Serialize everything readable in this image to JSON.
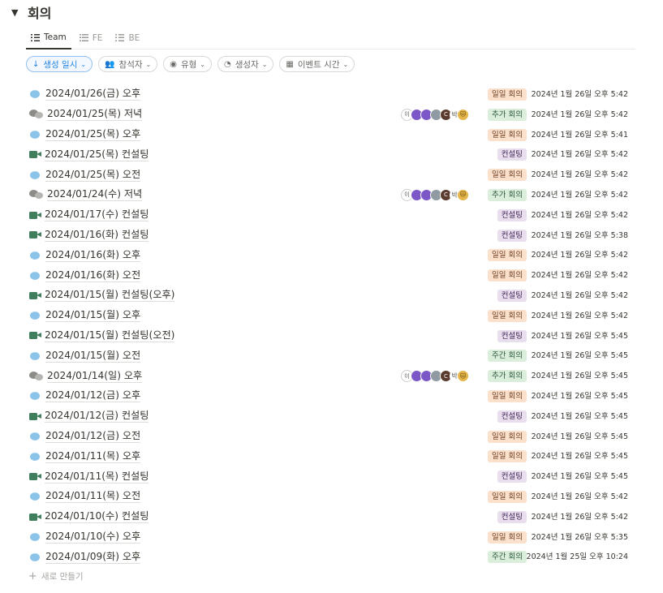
{
  "database": {
    "title": "회의",
    "toggle_icon": "▼"
  },
  "tabs": [
    {
      "label": "Team",
      "icon": "list-icon",
      "active": true
    },
    {
      "label": "FE",
      "icon": "list-icon",
      "active": false
    },
    {
      "label": "BE",
      "icon": "list-icon",
      "active": false
    }
  ],
  "filters": [
    {
      "label": "생성 일시",
      "icon": "↓",
      "kind": "sort"
    },
    {
      "label": "참석자",
      "icon": "👥",
      "kind": "filter"
    },
    {
      "label": "유형",
      "icon": "◉",
      "kind": "filter"
    },
    {
      "label": "생성자",
      "icon": "◔",
      "kind": "filter"
    },
    {
      "label": "이벤트 시간",
      "icon": "▦",
      "kind": "filter"
    }
  ],
  "rows": [
    {
      "icon": "chat",
      "title": "2024/01/26(금) 오후",
      "tag": "일일 회의",
      "tag_type": "daily",
      "created": "2024년 1월 26일 오후 5:42",
      "attendees": false
    },
    {
      "icon": "group",
      "title": "2024/01/25(목) 저녁",
      "tag": "추가 회의",
      "tag_type": "extra",
      "created": "2024년 1월 26일 오후 5:42",
      "attendees": true
    },
    {
      "icon": "chat",
      "title": "2024/01/25(목) 오후",
      "tag": "일일 회의",
      "tag_type": "daily",
      "created": "2024년 1월 26일 오후 5:41",
      "attendees": false
    },
    {
      "icon": "video",
      "title": "2024/01/25(목) 컨설팅",
      "tag": "컨설팅",
      "tag_type": "consult",
      "created": "2024년 1월 26일 오후 5:42",
      "attendees": false
    },
    {
      "icon": "chat",
      "title": "2024/01/25(목) 오전",
      "tag": "일일 회의",
      "tag_type": "daily",
      "created": "2024년 1월 26일 오후 5:42",
      "attendees": false
    },
    {
      "icon": "group",
      "title": "2024/01/24(수) 저녁",
      "tag": "추가 회의",
      "tag_type": "extra",
      "created": "2024년 1월 26일 오후 5:42",
      "attendees": true
    },
    {
      "icon": "video",
      "title": "2024/01/17(수) 컨설팅",
      "tag": "컨설팅",
      "tag_type": "consult",
      "created": "2024년 1월 26일 오후 5:42",
      "attendees": false
    },
    {
      "icon": "video",
      "title": "2024/01/16(화) 컨설팅",
      "tag": "컨설팅",
      "tag_type": "consult",
      "created": "2024년 1월 26일 오후 5:38",
      "attendees": false
    },
    {
      "icon": "chat",
      "title": "2024/01/16(화) 오후",
      "tag": "일일 회의",
      "tag_type": "daily",
      "created": "2024년 1월 26일 오후 5:42",
      "attendees": false
    },
    {
      "icon": "chat",
      "title": "2024/01/16(화) 오전",
      "tag": "일일 회의",
      "tag_type": "daily",
      "created": "2024년 1월 26일 오후 5:42",
      "attendees": false
    },
    {
      "icon": "video",
      "title": "2024/01/15(월) 컨설팅(오후)",
      "tag": "컨설팅",
      "tag_type": "consult",
      "created": "2024년 1월 26일 오후 5:42",
      "attendees": false
    },
    {
      "icon": "chat",
      "title": "2024/01/15(월) 오후",
      "tag": "일일 회의",
      "tag_type": "daily",
      "created": "2024년 1월 26일 오후 5:42",
      "attendees": false
    },
    {
      "icon": "video",
      "title": "2024/01/15(월) 컨설팅(오전)",
      "tag": "컨설팅",
      "tag_type": "consult",
      "created": "2024년 1월 26일 오후 5:45",
      "attendees": false
    },
    {
      "icon": "chat",
      "title": "2024/01/15(월) 오전",
      "tag": "주간 회의",
      "tag_type": "weekly",
      "created": "2024년 1월 26일 오후 5:45",
      "attendees": false
    },
    {
      "icon": "group",
      "title": "2024/01/14(일) 오후",
      "tag": "추가 회의",
      "tag_type": "extra",
      "created": "2024년 1월 26일 오후 5:45",
      "attendees": true
    },
    {
      "icon": "chat",
      "title": "2024/01/12(금) 오후",
      "tag": "일일 회의",
      "tag_type": "daily",
      "created": "2024년 1월 26일 오후 5:45",
      "attendees": false
    },
    {
      "icon": "video",
      "title": "2024/01/12(금) 컨설팅",
      "tag": "컨설팅",
      "tag_type": "consult",
      "created": "2024년 1월 26일 오후 5:45",
      "attendees": false
    },
    {
      "icon": "chat",
      "title": "2024/01/12(금) 오전",
      "tag": "일일 회의",
      "tag_type": "daily",
      "created": "2024년 1월 26일 오후 5:45",
      "attendees": false
    },
    {
      "icon": "chat",
      "title": "2024/01/11(목) 오후",
      "tag": "일일 회의",
      "tag_type": "daily",
      "created": "2024년 1월 26일 오후 5:45",
      "attendees": false
    },
    {
      "icon": "video",
      "title": "2024/01/11(목) 컨설팅",
      "tag": "컨설팅",
      "tag_type": "consult",
      "created": "2024년 1월 26일 오후 5:45",
      "attendees": false
    },
    {
      "icon": "chat",
      "title": "2024/01/11(목) 오전",
      "tag": "일일 회의",
      "tag_type": "daily",
      "created": "2024년 1월 26일 오후 5:42",
      "attendees": false
    },
    {
      "icon": "video",
      "title": "2024/01/10(수) 컨설팅",
      "tag": "컨설팅",
      "tag_type": "consult",
      "created": "2024년 1월 26일 오후 5:42",
      "attendees": false
    },
    {
      "icon": "chat",
      "title": "2024/01/10(수) 오후",
      "tag": "일일 회의",
      "tag_type": "daily",
      "created": "2024년 1월 26일 오후 5:35",
      "attendees": false
    },
    {
      "icon": "chat",
      "title": "2024/01/09(화) 오후",
      "tag": "주간 회의",
      "tag_type": "weekly",
      "created": "2024년 1월 25일 오후 10:24",
      "attendees": false
    }
  ],
  "attendee_avatars": [
    {
      "kind": "txt",
      "text": "이"
    },
    {
      "kind": "purple",
      "text": ""
    },
    {
      "kind": "purple",
      "text": ""
    },
    {
      "kind": "gray",
      "text": ""
    },
    {
      "kind": "dark",
      "text": "C"
    },
    {
      "kind": "txt2",
      "text": "박"
    },
    {
      "kind": "yel",
      "text": "🐱"
    }
  ],
  "new_item": {
    "icon": "+",
    "label": "새로 만들기"
  }
}
